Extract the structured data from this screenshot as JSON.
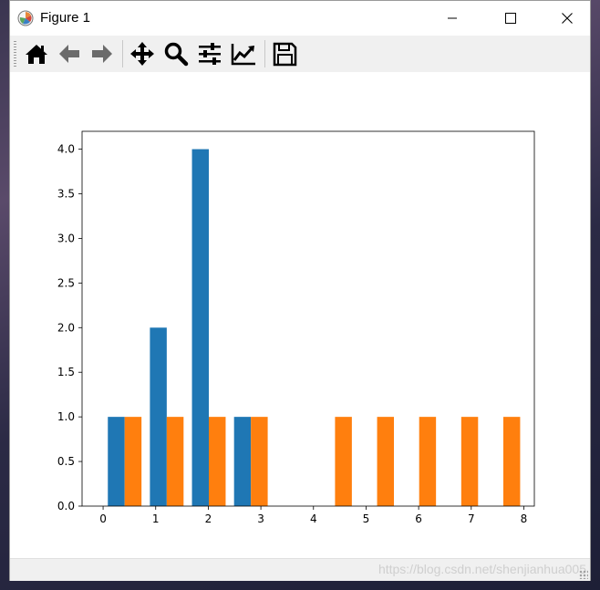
{
  "window": {
    "title": "Figure 1",
    "icon": "matplotlib-logo-icon",
    "controls": [
      "minimize-icon",
      "maximize-icon",
      "close-icon"
    ]
  },
  "toolbar": {
    "items": [
      {
        "name": "home",
        "icon": "home-icon"
      },
      {
        "name": "back",
        "icon": "arrow-left-icon"
      },
      {
        "name": "forward",
        "icon": "arrow-right-icon"
      },
      {
        "name": "pan",
        "icon": "move-icon"
      },
      {
        "name": "zoom",
        "icon": "magnifier-icon"
      },
      {
        "name": "subplots",
        "icon": "sliders-icon"
      },
      {
        "name": "edit-axes",
        "icon": "trend-chart-icon"
      },
      {
        "name": "save",
        "icon": "floppy-disk-icon"
      }
    ]
  },
  "watermark": "https://blog.csdn.net/shenjianhua005",
  "chart_data": {
    "type": "bar",
    "x": [
      0,
      1,
      2,
      3,
      4.5,
      5.3,
      6.1,
      7.0,
      7.8
    ],
    "series": [
      {
        "values": [
          1,
          2,
          4,
          1,
          0,
          0,
          0,
          0,
          0
        ],
        "color": "#1f77b4"
      },
      {
        "values": [
          1,
          1,
          1,
          1,
          1,
          1,
          1,
          1,
          1
        ],
        "color": "#ff7f0e"
      }
    ],
    "series_x": [
      [
        0.25,
        1.05,
        1.85,
        2.65
      ],
      [
        0.57,
        1.37,
        2.17,
        2.97,
        4.57,
        5.37,
        6.17,
        6.97,
        7.77
      ]
    ],
    "series_heights": [
      [
        1,
        2,
        4,
        1
      ],
      [
        1,
        1,
        1,
        1,
        1,
        1,
        1,
        1,
        1
      ]
    ],
    "bar_width": 0.32,
    "xlim": [
      -0.4,
      8.2
    ],
    "ylim": [
      0,
      4.2
    ],
    "xticks": [
      "0",
      "1",
      "2",
      "3",
      "4",
      "5",
      "6",
      "7",
      "8"
    ],
    "yticks": [
      "0.0",
      "0.5",
      "1.0",
      "1.5",
      "2.0",
      "2.5",
      "3.0",
      "3.5",
      "4.0"
    ],
    "title": "",
    "xlabel": "",
    "ylabel": "",
    "grid": false
  }
}
